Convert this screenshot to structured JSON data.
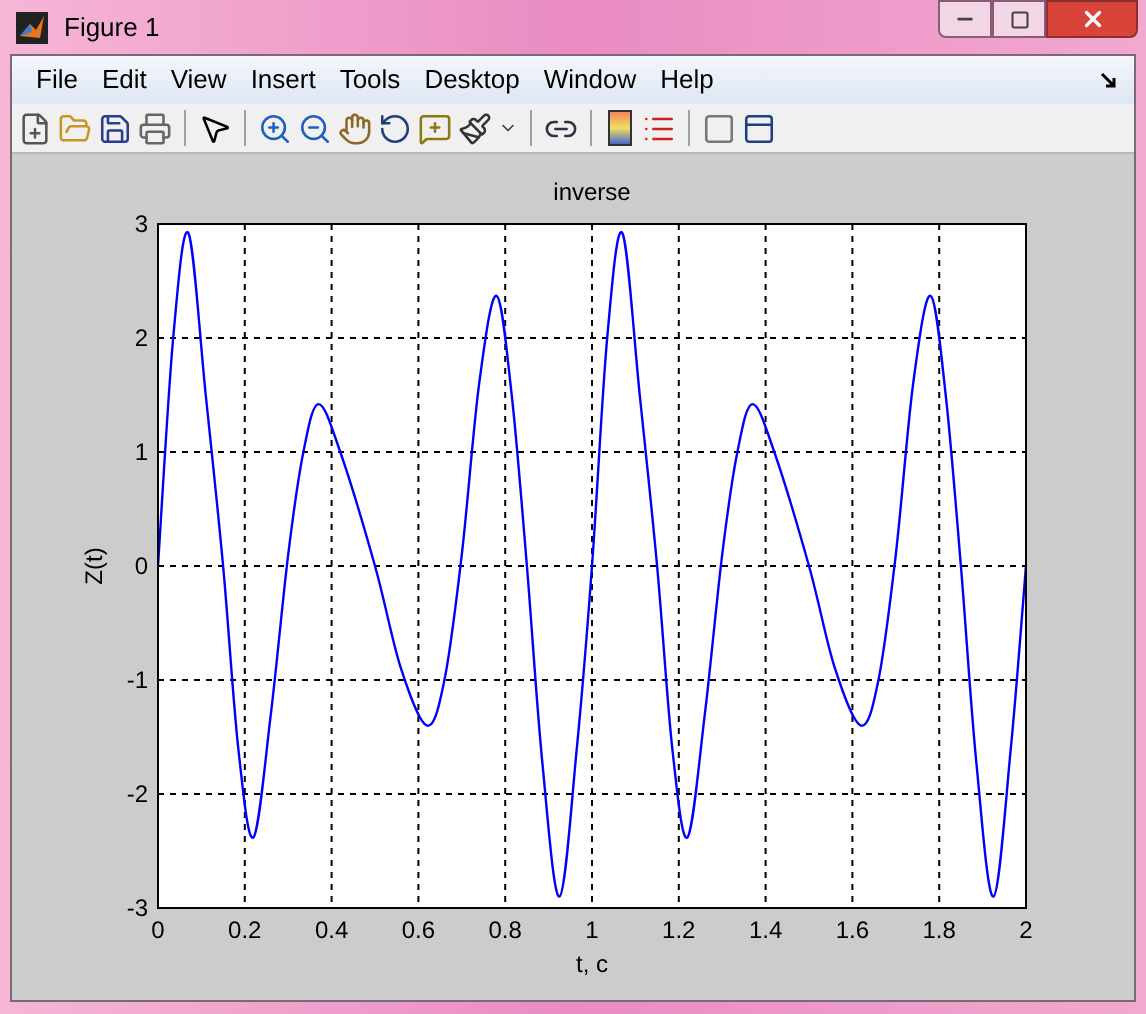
{
  "window": {
    "title": "Figure 1"
  },
  "menu": [
    "File",
    "Edit",
    "View",
    "Insert",
    "Tools",
    "Desktop",
    "Window",
    "Help"
  ],
  "chart_data": {
    "type": "line",
    "title": "inverse",
    "xlabel": "t, c",
    "ylabel": "Z(t)",
    "xlim": [
      0,
      2
    ],
    "ylim": [
      -3,
      3
    ],
    "xticks": [
      0,
      0.2,
      0.4,
      0.6,
      0.8,
      1,
      1.2,
      1.4,
      1.6,
      1.8,
      2
    ],
    "yticks": [
      -3,
      -2,
      -1,
      0,
      1,
      2,
      3
    ],
    "x": [
      0,
      0.035,
      0.07,
      0.11,
      0.15,
      0.185,
      0.22,
      0.26,
      0.3,
      0.335,
      0.37,
      0.42,
      0.5,
      0.56,
      0.62,
      0.66,
      0.7,
      0.74,
      0.78,
      0.815,
      0.85,
      0.885,
      0.925,
      0.965,
      1,
      1.035,
      1.07,
      1.11,
      1.15,
      1.185,
      1.22,
      1.26,
      1.3,
      1.335,
      1.37,
      1.42,
      1.5,
      1.56,
      1.62,
      1.66,
      1.7,
      1.74,
      1.78,
      1.815,
      1.85,
      1.885,
      1.925,
      1.965,
      2
    ],
    "grid": true,
    "series": [
      {
        "color": "#0000ff",
        "values": [
          0,
          2.0,
          2.92,
          1.5,
          0,
          -1.6,
          -2.38,
          -1.3,
          0.1,
          1.0,
          1.42,
          1.0,
          0,
          -0.9,
          -1.4,
          -1.0,
          0.1,
          1.6,
          2.37,
          1.5,
          0,
          -1.7,
          -2.9,
          -1.6,
          0,
          2.0,
          2.92,
          1.5,
          0,
          -1.6,
          -2.38,
          -1.3,
          0.1,
          1.0,
          1.42,
          1.0,
          0,
          -0.9,
          -1.4,
          -1.0,
          0.1,
          1.6,
          2.37,
          1.5,
          0,
          -1.7,
          -2.9,
          -1.6,
          0
        ]
      }
    ]
  }
}
